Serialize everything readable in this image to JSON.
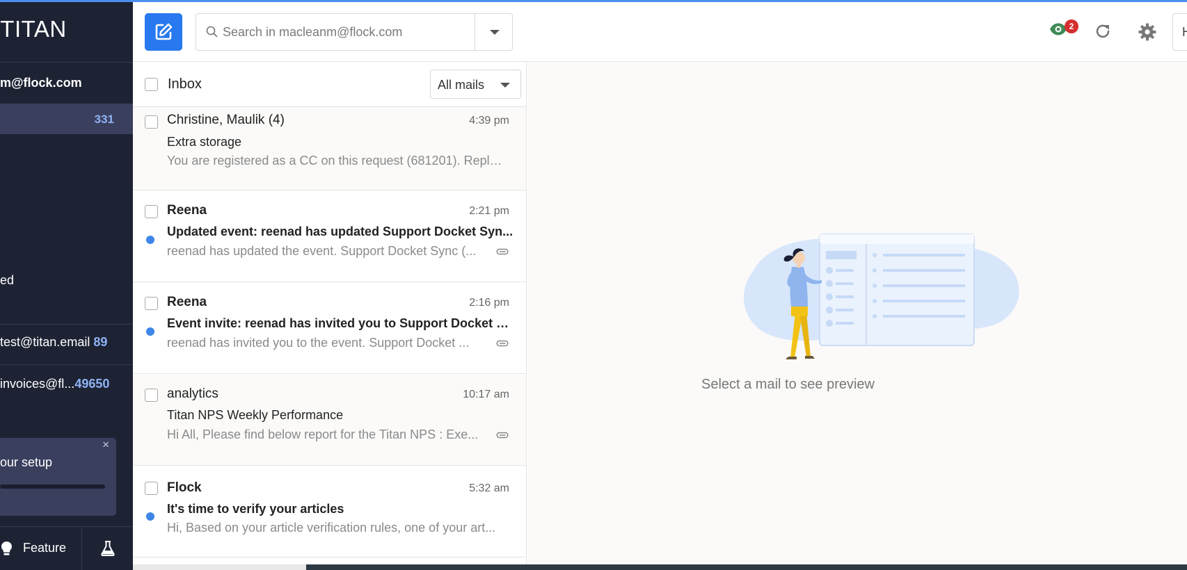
{
  "app": {
    "logo_text": "TITAN"
  },
  "sidebar": {
    "account": "m@flock.com",
    "inbox_count": "331",
    "folder_partial": "ed",
    "other_accounts": [
      {
        "label": "test@titan.email",
        "count": "89"
      },
      {
        "label": "invoices@fl...",
        "count": "49650"
      }
    ],
    "setup": {
      "label": "our setup",
      "close": "×"
    },
    "feature_label": "Feature"
  },
  "header": {
    "search_placeholder": "Search in macleanm@flock.com",
    "notification_count": "2",
    "user_initial": "H"
  },
  "list": {
    "title": "Inbox",
    "filter": "All mails",
    "mails": [
      {
        "sender": "Christine, Maulik (4)",
        "time": "4:39 pm",
        "subject": "Extra storage",
        "preview": "You are registered as a CC on this request (681201). Reply...",
        "unread": false,
        "attachment": false
      },
      {
        "sender": "Reena",
        "time": "2:21 pm",
        "subject": "Updated event: reenad has updated Support Docket Syn...",
        "preview": "reenad has updated the event. Support Docket Sync (...",
        "unread": true,
        "attachment": true
      },
      {
        "sender": "Reena",
        "time": "2:16 pm",
        "subject": "Event invite: reenad has invited you to Support Docket S...",
        "preview": "reenad has invited you to the event. Support Docket ...",
        "unread": true,
        "attachment": true
      },
      {
        "sender": "analytics",
        "time": "10:17 am",
        "subject": "Titan NPS Weekly Performance",
        "preview": "Hi All, Please find below report for the Titan NPS : Exe...",
        "unread": false,
        "attachment": true
      },
      {
        "sender": "Flock",
        "time": "5:32 am",
        "subject": "It's time to verify your articles",
        "preview": "Hi, Based on your article verification rules, one of your art...",
        "unread": true,
        "attachment": false
      }
    ]
  },
  "preview": {
    "empty_text": "Select a mail to see preview"
  },
  "colors": {
    "sidebar_bg": "#1e2334",
    "accent": "#2879f0",
    "unread_dot": "#3f86e8",
    "badge": "#d62e2e"
  }
}
